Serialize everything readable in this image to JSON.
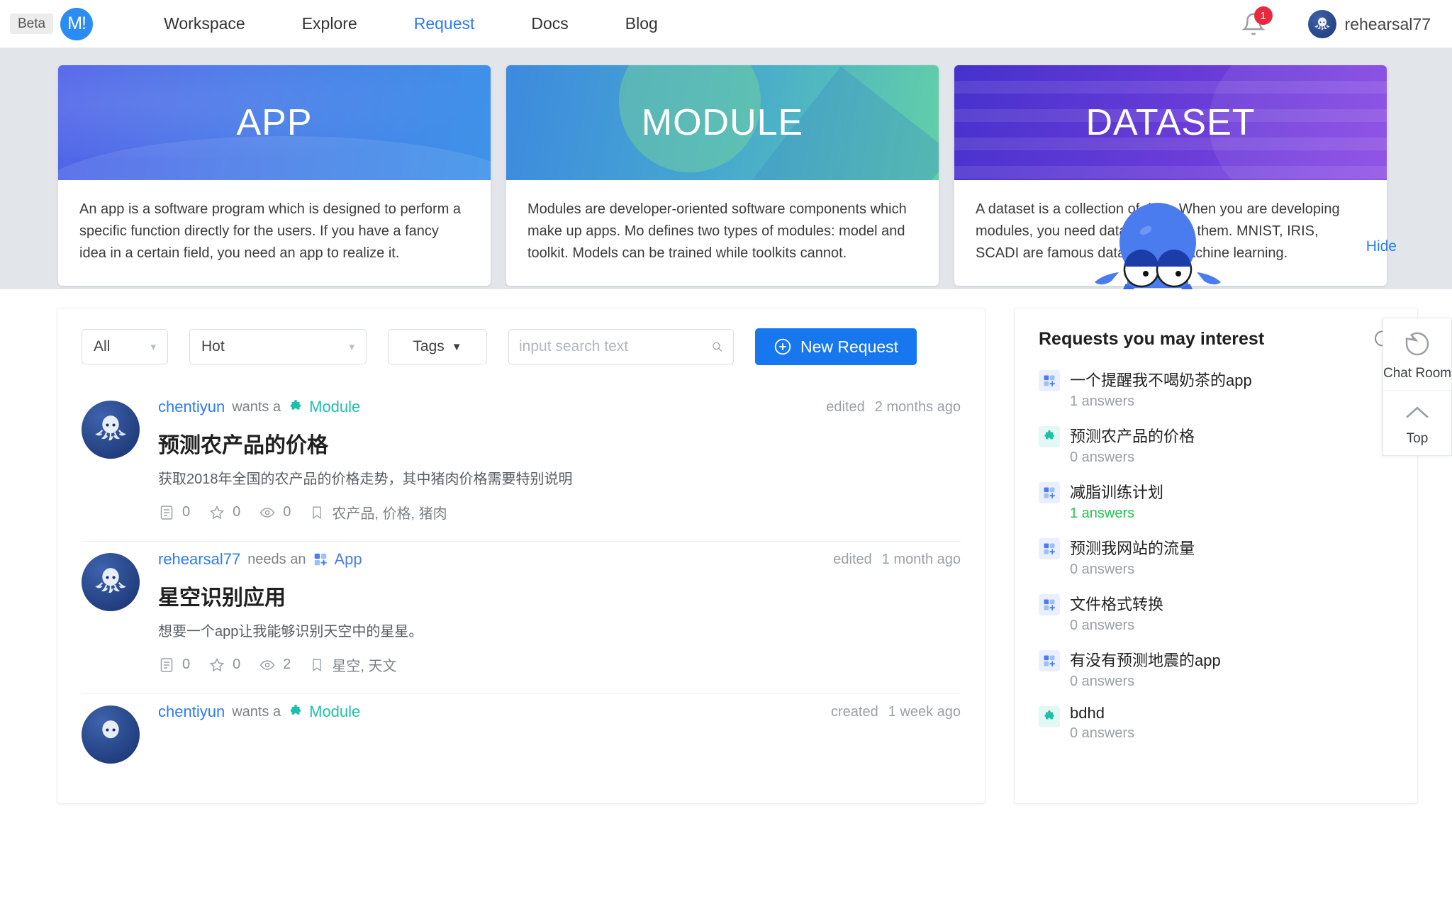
{
  "header": {
    "beta_label": "Beta",
    "logo_text": "M!",
    "nav": [
      {
        "label": "Workspace",
        "active": false
      },
      {
        "label": "Explore",
        "active": false
      },
      {
        "label": "Request",
        "active": true
      },
      {
        "label": "Docs",
        "active": false
      },
      {
        "label": "Blog",
        "active": false
      }
    ],
    "notification_count": "1",
    "username": "rehearsal77"
  },
  "cards": [
    {
      "title": "APP",
      "body": "An app is a software program which is designed to perform a specific function directly for the users. If you have a fancy idea in a certain field, you need an app to realize it.",
      "accent": "#4a7ce8"
    },
    {
      "title": "MODULE",
      "body": "Modules are developer-oriented software components which make up apps. Mo defines two types of modules: model and toolkit. Models can be trained while toolkits cannot.",
      "accent": "#46a8cf"
    },
    {
      "title": "DATASET",
      "body": "A dataset is a collection of data. When you are developing modules, you need dataset to train them. MNIST, IRIS, SCADI are famous datasets for machine learning.",
      "accent": "#6a3cd8"
    }
  ],
  "hide_link": "Hide",
  "filters": {
    "type_select": "All",
    "sort_select": "Hot",
    "tags_select": "Tags",
    "search_placeholder": "input search text",
    "search_value": "",
    "new_request_label": "New Request"
  },
  "requests": [
    {
      "user": "chentiyun",
      "verb": "wants a",
      "type": "Module",
      "type_kind": "module",
      "time_action": "edited",
      "time_ago": "2 months ago",
      "title": "预测农产品的价格",
      "desc": "获取2018年全国的农产品的价格走势，其中猪肉价格需要特别说明",
      "answers": "0",
      "stars": "0",
      "views": "0",
      "tags": "农产品, 价格, 猪肉"
    },
    {
      "user": "rehearsal77",
      "verb": "needs an",
      "type": "App",
      "type_kind": "app",
      "time_action": "edited",
      "time_ago": "1 month ago",
      "title": "星空识别应用",
      "desc": "想要一个app让我能够识别天空中的星星。",
      "answers": "0",
      "stars": "0",
      "views": "2",
      "tags": "星空, 天文"
    },
    {
      "user": "chentiyun",
      "verb": "wants a",
      "type": "Module",
      "type_kind": "module",
      "time_action": "created",
      "time_ago": "1 week ago",
      "title": "",
      "desc": "",
      "answers": "",
      "stars": "",
      "views": "",
      "tags": ""
    }
  ],
  "sidebar": {
    "title": "Requests you may interest",
    "items": [
      {
        "name": "一个提醒我不喝奶茶的app",
        "answers": "1 answers",
        "kind": "app",
        "highlight": false
      },
      {
        "name": "预测农产品的价格",
        "answers": "0 answers",
        "kind": "module",
        "highlight": false
      },
      {
        "name": "减脂训练计划",
        "answers": "1 answers",
        "kind": "app",
        "highlight": true
      },
      {
        "name": "预测我网站的流量",
        "answers": "0 answers",
        "kind": "app",
        "highlight": false
      },
      {
        "name": "文件格式转换",
        "answers": "0 answers",
        "kind": "app",
        "highlight": false
      },
      {
        "name": "有没有预测地震的app",
        "answers": "0 answers",
        "kind": "app",
        "highlight": false
      },
      {
        "name": "bdhd",
        "answers": "0 answers",
        "kind": "module",
        "highlight": false
      }
    ]
  },
  "float_panel": {
    "chat_label": "Chat Room",
    "top_label": "Top"
  }
}
